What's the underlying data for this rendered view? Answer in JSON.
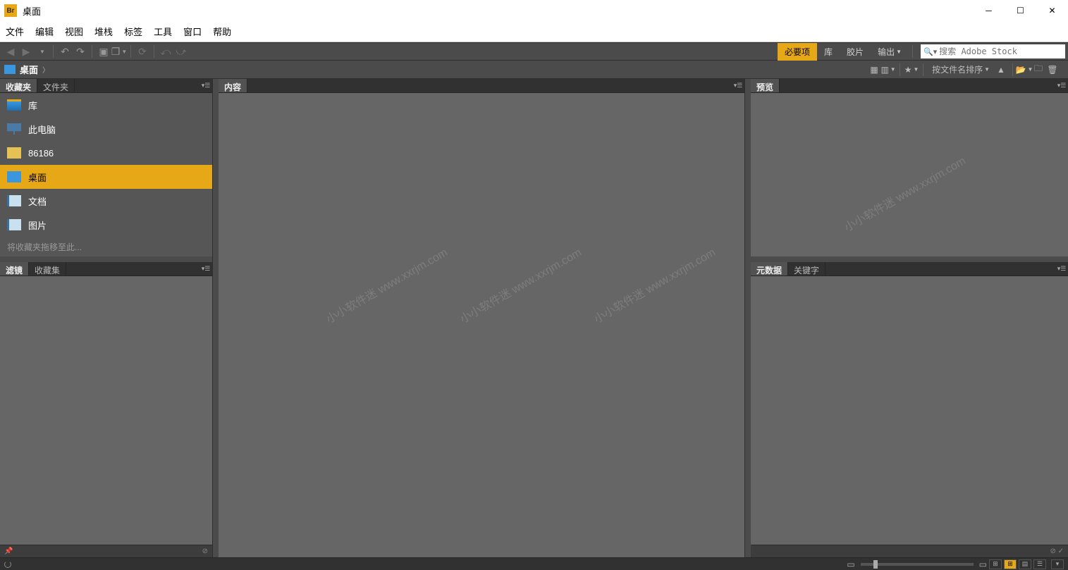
{
  "title": "桌面",
  "app_icon_text": "Br",
  "menu": [
    "文件",
    "编辑",
    "视图",
    "堆栈",
    "标签",
    "工具",
    "窗口",
    "帮助"
  ],
  "workspace_tabs": [
    {
      "label": "必要项",
      "active": true
    },
    {
      "label": "库",
      "active": false
    },
    {
      "label": "胶片",
      "active": false
    },
    {
      "label": "输出",
      "active": false
    }
  ],
  "search_placeholder": "搜索 Adobe Stock",
  "breadcrumb": {
    "label": "桌面"
  },
  "sort_label": "按文件名排序",
  "panels": {
    "favorites": {
      "tabs": [
        "收藏夹",
        "文件夹"
      ],
      "active": 0,
      "hint": "将收藏夹拖移至此...",
      "items": [
        {
          "label": "库",
          "icon": "ic-lib",
          "sel": false
        },
        {
          "label": "此电脑",
          "icon": "ic-pc",
          "sel": false
        },
        {
          "label": "86186",
          "icon": "ic-folder",
          "sel": false
        },
        {
          "label": "桌面",
          "icon": "ic-blue",
          "sel": true
        },
        {
          "label": "文档",
          "icon": "ic-doc",
          "sel": false
        },
        {
          "label": "图片",
          "icon": "ic-pic",
          "sel": false
        }
      ]
    },
    "filter": {
      "tabs": [
        "滤镜",
        "收藏集"
      ],
      "active": 0
    },
    "content": {
      "tabs": [
        "内容"
      ],
      "active": 0
    },
    "preview": {
      "tabs": [
        "预览"
      ],
      "active": 0
    },
    "metadata": {
      "tabs": [
        "元数据",
        "关键字"
      ],
      "active": 0
    }
  },
  "watermark": "小小软件迷 www.xxrjm.com"
}
